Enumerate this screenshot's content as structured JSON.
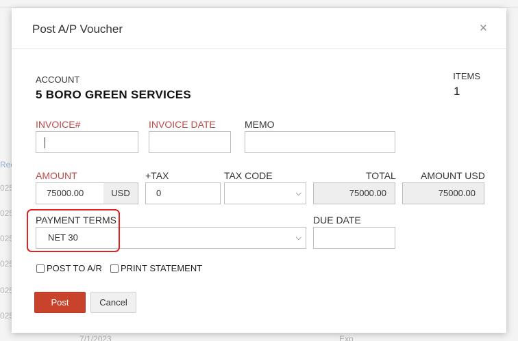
{
  "modal": {
    "title": "Post A/P Voucher",
    "close_glyph": "×"
  },
  "account": {
    "label": "ACCOUNT",
    "name": "5 BORO GREEN SERVICES"
  },
  "items": {
    "label": "ITEMS",
    "count": "1"
  },
  "fields": {
    "invoice_label": "INVOICE#",
    "invoice_value": "",
    "invoice_date_label": "INVOICE DATE",
    "invoice_date_value": "",
    "memo_label": "MEMO",
    "memo_value": "",
    "amount_label": "AMOUNT",
    "amount_value": "75000.00",
    "currency": "USD",
    "tax_label": "+TAX",
    "tax_value": "0",
    "tax_code_label": "TAX CODE",
    "tax_code_value": "",
    "total_label": "TOTAL",
    "total_value": "75000.00",
    "amount_usd_label": "AMOUNT USD",
    "amount_usd_value": "75000.00",
    "payment_terms_label": "PAYMENT TERMS",
    "payment_terms_value": "NET 30",
    "due_date_label": "DUE DATE",
    "due_date_value": ""
  },
  "options": {
    "post_ar_label": "POST TO A/R",
    "post_ar_checked": false,
    "print_statement_label": "PRINT STATEMENT",
    "print_statement_checked": false
  },
  "actions": {
    "post_label": "Post",
    "cancel_label": "Cancel"
  },
  "background": {
    "left_fragments": [
      "Rec",
      "025",
      "025",
      "025",
      "025",
      "025",
      "025"
    ],
    "bottom_date": "7/1/2023",
    "bottom_col": "Exp"
  },
  "colors": {
    "required_label": "#b94a48",
    "post_button": "#c9432c",
    "highlight_box": "#e02020"
  }
}
